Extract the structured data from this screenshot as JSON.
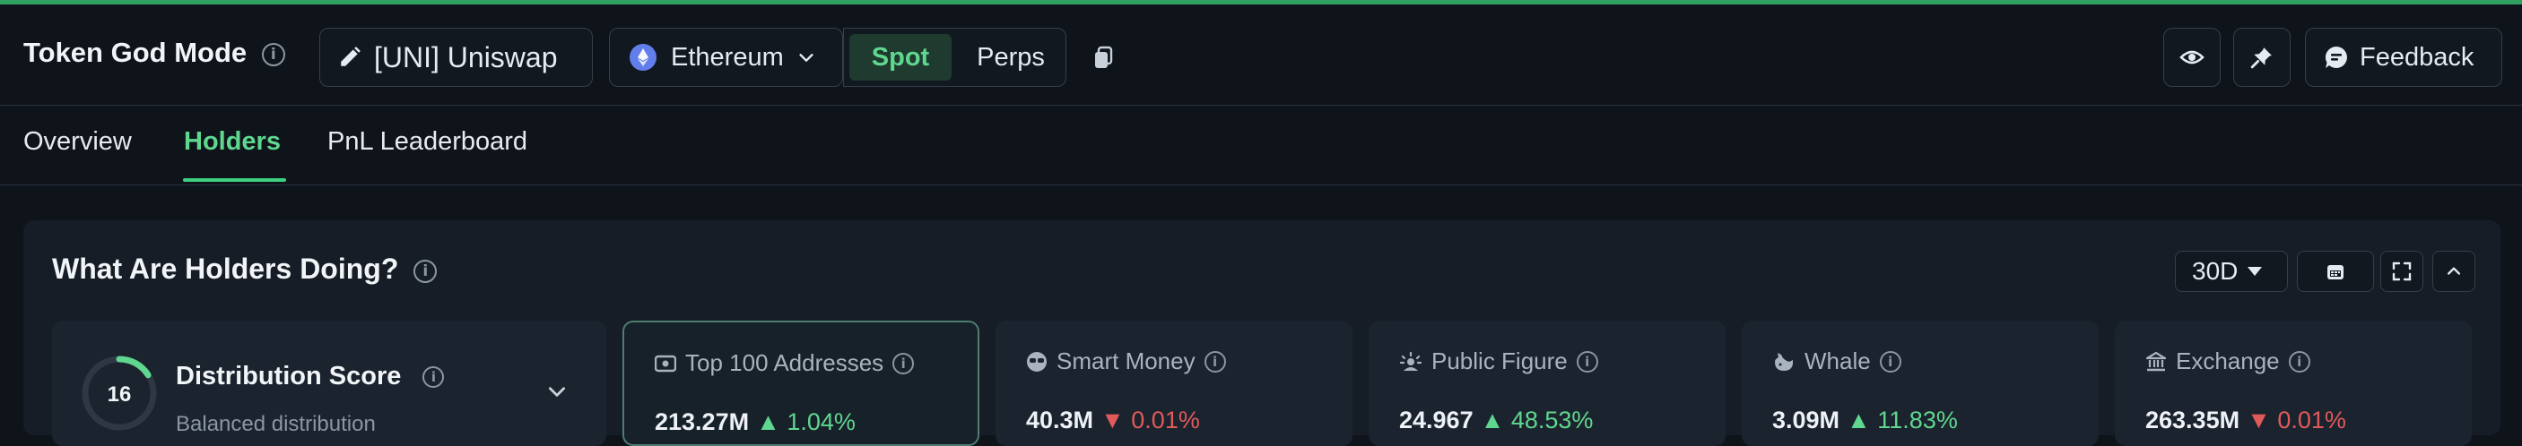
{
  "header": {
    "title": "Token God Mode",
    "token_label": "[UNI] Uniswap",
    "chain_label": "Ethereum",
    "market_options": [
      "Spot",
      "Perps"
    ],
    "selected_market": "Spot",
    "feedback_label": "Feedback"
  },
  "tabs": [
    {
      "label": "Overview",
      "active": false
    },
    {
      "label": "Holders",
      "active": true
    },
    {
      "label": "PnL Leaderboard",
      "active": false
    }
  ],
  "panel": {
    "title": "What Are Holders Doing?",
    "period": "30D",
    "distribution": {
      "score": "16",
      "score_fraction": 0.16,
      "title": "Distribution Score",
      "subtitle": "Balanced distribution"
    },
    "cards": [
      {
        "label": "Top 100 Addresses",
        "icon": "wallet-icon",
        "value": "213.27M",
        "change": "1.04%",
        "direction": "up",
        "selected": true
      },
      {
        "label": "Smart Money",
        "icon": "smart-money-icon",
        "value": "40.3M",
        "change": "0.01%",
        "direction": "down",
        "selected": false
      },
      {
        "label": "Public Figure",
        "icon": "public-figure-icon",
        "value": "24.967",
        "change": "48.53%",
        "direction": "up",
        "selected": false
      },
      {
        "label": "Whale",
        "icon": "whale-icon",
        "value": "3.09M",
        "change": "11.83%",
        "direction": "up",
        "selected": false
      },
      {
        "label": "Exchange",
        "icon": "exchange-icon",
        "value": "263.35M",
        "change": "0.01%",
        "direction": "down",
        "selected": false
      }
    ]
  },
  "colors": {
    "background": "#0f141b",
    "accent_green": "#5fd78f",
    "negative_red": "#e05a5a",
    "ethereum": "#627eea"
  }
}
